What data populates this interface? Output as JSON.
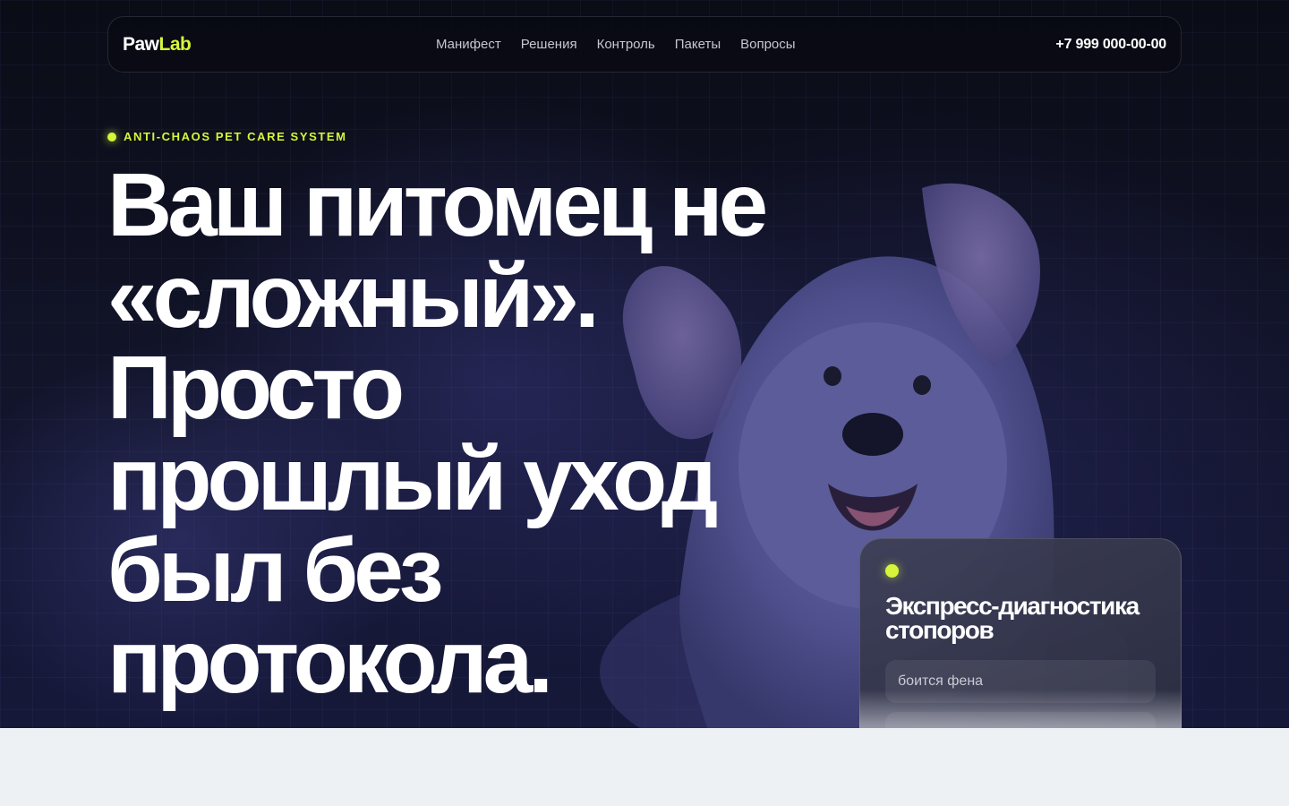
{
  "brand": {
    "name_part1": "Paw",
    "name_part2": "Lab",
    "accent_color": "#d7f53a"
  },
  "nav": {
    "items": [
      {
        "label": "Манифест"
      },
      {
        "label": "Решения"
      },
      {
        "label": "Контроль"
      },
      {
        "label": "Пакеты"
      },
      {
        "label": "Вопросы"
      }
    ]
  },
  "header": {
    "phone": "+7 999 000-00-00"
  },
  "hero": {
    "eyebrow": "ANTI-CHAOS PET CARE SYSTEM",
    "headline_lines": [
      "Ваш питомец не",
      "«сложный».",
      "Просто",
      "прошлый уход",
      "был без",
      "протокола."
    ],
    "image": "dog-photo"
  },
  "diagnostic_card": {
    "title_line1": "Экспресс-диагностика",
    "title_line2": "стопоров",
    "options": [
      {
        "label": "боится фена"
      },
      {
        "label": ""
      }
    ]
  }
}
